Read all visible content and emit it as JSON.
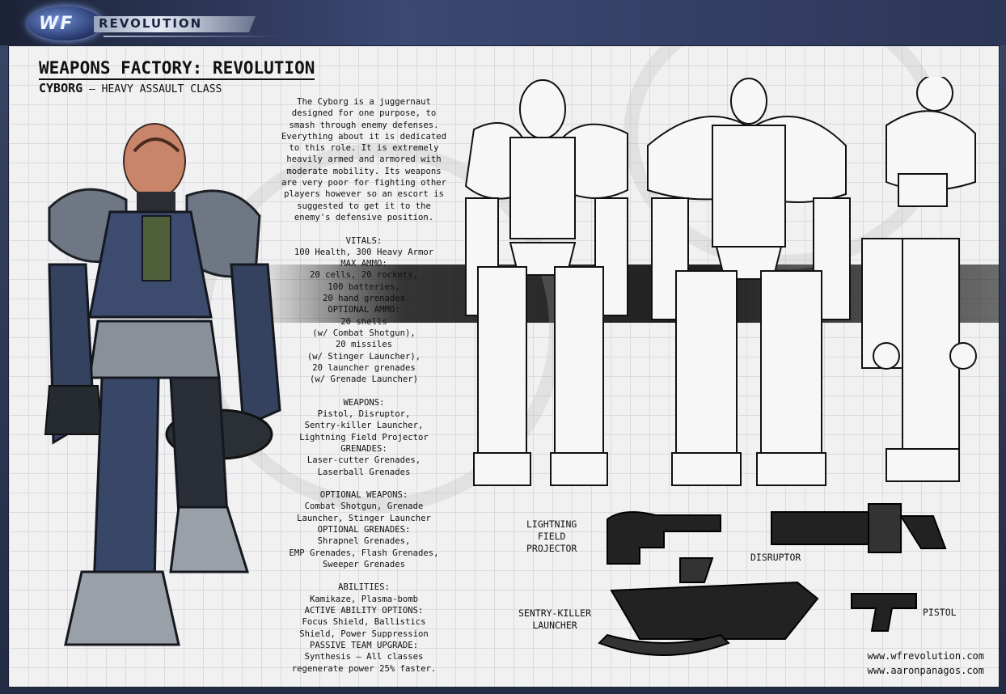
{
  "header": {
    "logo_wf": "WF",
    "logo_revolution": "REVOLUTION"
  },
  "sheet": {
    "title": "WEAPONS FACTORY: REVOLUTION",
    "class_name": "CYBORG",
    "class_desc": " – HEAVY ASSAULT CLASS",
    "description": [
      "The Cyborg is a juggernaut",
      "designed for one purpose, to",
      "smash through enemy defenses.",
      "Everything about it is dedicated",
      "to this role. It is extremely",
      "heavily armed and armored with",
      "moderate mobility. Its weapons",
      "are very poor for fighting other",
      "players however so an escort is",
      "suggested to get it to the",
      "enemy's defensive position."
    ],
    "vitals": [
      "VITALS:",
      "100 Health, 300 Heavy Armor",
      "MAX AMMO:",
      "20 cells, 20 rockets,",
      "100 batteries,",
      "20 hand grenades",
      "OPTIONAL AMMO:",
      "20 shells",
      "(w/ Combat Shotgun),",
      "20 missiles",
      "(w/ Stinger Launcher),",
      "20 launcher grenades",
      "(w/ Grenade Launcher)"
    ],
    "weapons": [
      "WEAPONS:",
      "Pistol, Disruptor,",
      "Sentry-killer Launcher,",
      "Lightning Field Projector",
      "GRENADES:",
      "Laser-cutter Grenades,",
      "Laserball Grenades"
    ],
    "optional": [
      "OPTIONAL WEAPONS:",
      "Combat Shotgun, Grenade",
      "Launcher, Stinger Launcher",
      "OPTIONAL GRENADES:",
      "Shrapnel Grenades,",
      "EMP Grenades, Flash Grenades,",
      "Sweeper Grenades"
    ],
    "abilities": [
      "ABILITIES:",
      "Kamikaze, Plasma-bomb",
      "ACTIVE ABILITY OPTIONS:",
      "Focus Shield, Ballistics",
      "Shield, Power Suppression",
      "PASSIVE TEAM UPGRADE:",
      "Synthesis – All classes",
      "regenerate power 25% faster."
    ],
    "weapon_labels": {
      "lightning": [
        "LIGHTNING",
        "FIELD",
        "PROJECTOR"
      ],
      "disruptor": "DISRUPTOR",
      "sentry": [
        "SENTRY-KILLER",
        "LAUNCHER"
      ],
      "pistol": "PISTOL"
    },
    "urls": [
      "www.wfrevolution.com",
      "www.aaronpanagos.com"
    ]
  }
}
